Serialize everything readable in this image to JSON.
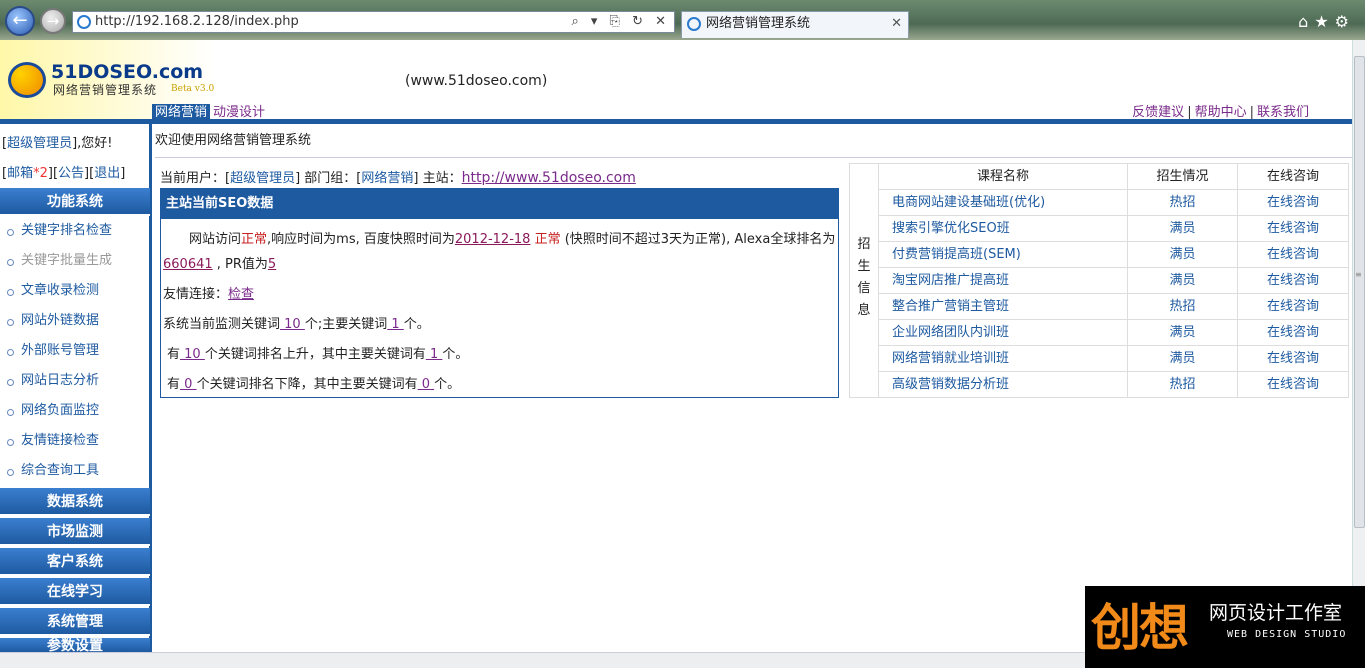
{
  "browser": {
    "url": "http://192.168.2.128/index.php",
    "tab_title": "网络营销管理系统"
  },
  "header": {
    "brand": "51DOSEO.com",
    "subtitle": "网络营销管理系统",
    "beta": "Beta v3.0",
    "site_url": "(www.51doseo.com)",
    "menu": [
      "网络营销",
      "动漫设计"
    ],
    "links": [
      "反馈建议",
      "帮助中心",
      "联系我们"
    ]
  },
  "sidebar": {
    "greeting_pre": "[",
    "user": "超级管理员",
    "greeting_post": "],您好!",
    "mail_label": "邮箱",
    "mail_count": "*2",
    "notice": "公告",
    "logout": "退出",
    "sections": [
      {
        "title": "功能系统",
        "items": [
          "关键字排名检查",
          "关键字批量生成",
          "文章收录检测",
          "网站外链数据",
          "外部账号管理",
          "网站日志分析",
          "网络负面监控",
          "友情链接检查",
          "综合查询工具"
        ]
      },
      {
        "title": "数据系统"
      },
      {
        "title": "市场监测"
      },
      {
        "title": "客户系统"
      },
      {
        "title": "在线学习"
      },
      {
        "title": "系统管理"
      },
      {
        "title": "参数设置"
      }
    ]
  },
  "main": {
    "welcome": "欢迎使用网络营销管理系统",
    "user_label": "当前用户：[",
    "user": "超级管理员",
    "dept_label": "] 部门组：[",
    "dept": "网络营销",
    "site_label": "]  主站：",
    "site": "http://www.51doseo.com",
    "seo_title": "主站当前SEO数据",
    "p1_a": "网站访问",
    "p1_status": "正常",
    "p1_b": ",响应时间为ms, 百度快照时间为",
    "p1_date": "2012-12-18",
    "p1_status2": " 正常",
    "p1_c": " (快照时间不超过3天为正常), Alexa全球排名为",
    "p1_alexa": "660641",
    "p1_d": " , PR值为",
    "p1_pr": "5",
    "friend_label": "友情连接：",
    "friend_link": "检查",
    "kw_a": "系统当前监测关键词",
    "kw_total": " 10 ",
    "kw_b": "个;主要关键词",
    "kw_main": " 1 ",
    "kw_c": "个。",
    "up_a": "有",
    "up_count": " 10 ",
    "up_b": "个关键词排名上升，其中主要关键词有",
    "up_main": " 1 ",
    "up_c": "个。",
    "down_a": "有",
    "down_count": " 0 ",
    "down_b": "个关键词排名下降，其中主要关键词有",
    "down_main": " 0 ",
    "down_c": "个。"
  },
  "courses": {
    "side_label": [
      "招",
      "生",
      "信",
      "息"
    ],
    "headers": [
      "课程名称",
      "招生情况",
      "在线咨询"
    ],
    "rows": [
      [
        "电商网站建设基础班(优化)",
        "热招",
        "在线咨询"
      ],
      [
        "搜索引擎优化SEO班",
        "满员",
        "在线咨询"
      ],
      [
        "付费营销提高班(SEM)",
        "满员",
        "在线咨询"
      ],
      [
        "淘宝网店推广提高班",
        "满员",
        "在线咨询"
      ],
      [
        "整合推广营销主管班",
        "热招",
        "在线咨询"
      ],
      [
        "企业网络团队内训班",
        "满员",
        "在线咨询"
      ],
      [
        "网络营销就业培训班",
        "满员",
        "在线咨询"
      ],
      [
        "高级营销数据分析班",
        "热招",
        "在线咨询"
      ]
    ]
  },
  "watermark": {
    "big": "创想",
    "cn": "网页设计工作室",
    "en": "WEB DESIGN STUDIO"
  }
}
